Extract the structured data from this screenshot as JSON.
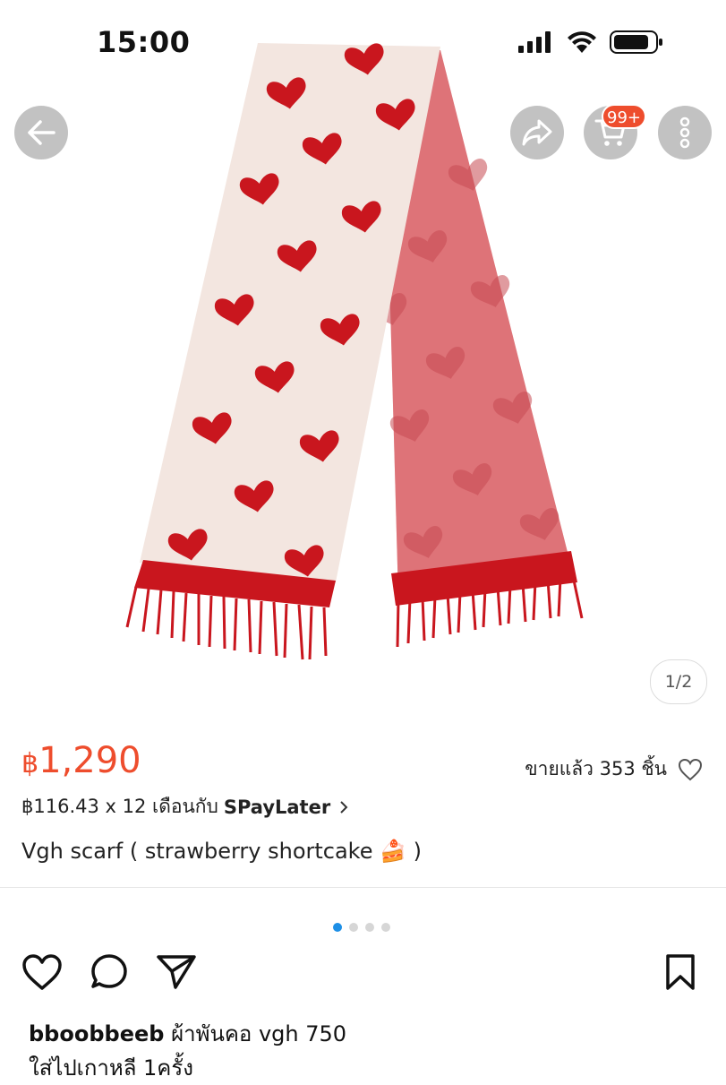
{
  "status_bar": {
    "time": "15:00"
  },
  "header": {
    "cart_badge": "99+",
    "back_icon": "arrow-left-icon",
    "share_icon": "share-arrow-icon",
    "cart_icon": "cart-icon",
    "more_icon": "more-vertical-icon"
  },
  "gallery": {
    "counter": "1/2"
  },
  "product": {
    "currency": "฿",
    "price": "1,290",
    "sold_text": "ขายแล้ว 353 ชิ้น",
    "installment_prefix": "฿116.43 x 12 เดือนกับ",
    "installment_brand": "SPayLater",
    "title": "Vgh scarf ( strawberry shortcake 🍰 )"
  },
  "carousel": {
    "count": 4,
    "active_index": 0
  },
  "post": {
    "username": "bboobbeeb",
    "caption": "ผ้าพันคอ vgh 750",
    "caption_line2": "ใส่ไปเกาหลี 1ครั้ง"
  },
  "colors": {
    "accent": "#ee4d2d",
    "dot_active": "#1d8fe6",
    "scarf_red": "#c9161e",
    "scarf_cream": "#f3e6e0"
  }
}
